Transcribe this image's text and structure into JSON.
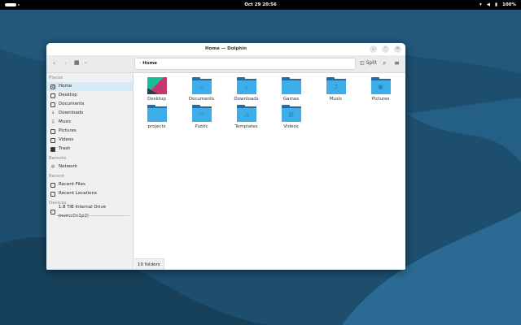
{
  "topbar": {
    "clock": "Oct 29  20:56",
    "battery": "100%"
  },
  "window": {
    "title": "Home — Dolphin",
    "buttons": [
      "⌄",
      "⌃",
      "✕"
    ]
  },
  "toolbar": {
    "back": "‹",
    "forward": "›",
    "view": "▦",
    "view_menu": "⌄",
    "breadcrumb_sep": "›",
    "breadcrumb": "Home",
    "split": "Split",
    "search": "⌕",
    "menu": "≡",
    "split_icon": "◫"
  },
  "sidebar": {
    "places_header": "Places",
    "places": [
      {
        "label": "Home",
        "icon": "⌂"
      },
      {
        "label": "Desktop",
        "icon": ""
      },
      {
        "label": "Documents",
        "icon": ""
      },
      {
        "label": "Downloads",
        "icon": "↓"
      },
      {
        "label": "Music",
        "icon": "♫"
      },
      {
        "label": "Pictures",
        "icon": ""
      },
      {
        "label": "Videos",
        "icon": ""
      },
      {
        "label": "Trash",
        "icon": ""
      }
    ],
    "remote_header": "Remote",
    "remote": [
      {
        "label": "Network",
        "icon": "◎"
      }
    ],
    "recent_header": "Recent",
    "recent": [
      {
        "label": "Recent Files"
      },
      {
        "label": "Recent Locations"
      }
    ],
    "devices_header": "Devices",
    "devices": [
      {
        "label": "1.8 TiB Internal Drive (nvme0n1p2)",
        "usage": 0.15
      }
    ]
  },
  "files": [
    {
      "name": "Desktop"
    },
    {
      "name": "Documents",
      "glyph": "▫"
    },
    {
      "name": "Downloads",
      "glyph": "⤓"
    },
    {
      "name": "Games",
      "glyph": ""
    },
    {
      "name": "Music",
      "glyph": "♫"
    },
    {
      "name": "Pictures",
      "glyph": "▣"
    },
    {
      "name": "projects",
      "glyph": ""
    },
    {
      "name": "Public",
      "glyph": "⚇"
    },
    {
      "name": "Templates",
      "glyph": "◿"
    },
    {
      "name": "Videos",
      "glyph": "▤"
    }
  ],
  "status": "10 folders",
  "colors": {
    "accent": "#3daee9",
    "folder_dark": "#1d6fa5",
    "background": "#1d4e6e"
  }
}
